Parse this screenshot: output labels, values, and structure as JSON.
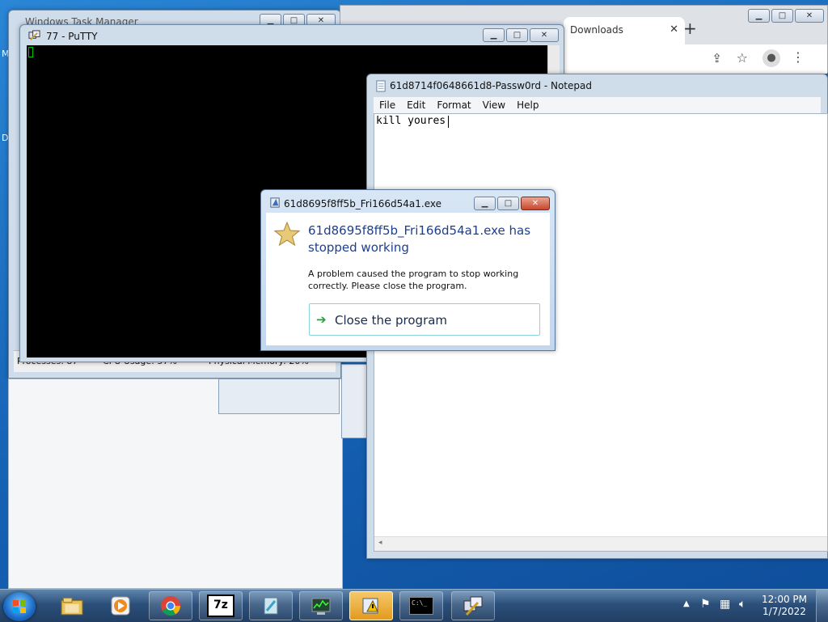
{
  "desktop": {
    "left_letter_1": "M",
    "left_letter_2": "D"
  },
  "task_manager": {
    "title": "Windows Task Manager",
    "status": {
      "processes": "Processes: 87",
      "cpu": "CPU Usage: 57%",
      "memory": "Physical Memory: 20%"
    }
  },
  "putty": {
    "title": "77 - PuTTY"
  },
  "chrome": {
    "tab_label": "Downloads",
    "new_tab": "+"
  },
  "notepad": {
    "title": "61d8714f0648661d8-Passw0rd - Notepad",
    "menu": [
      "File",
      "Edit",
      "Format",
      "View",
      "Help"
    ],
    "content": "kill youres"
  },
  "error_dialog": {
    "title": "61d8695f8ff5b_Fri166d54a1.exe",
    "heading": "61d8695f8ff5b_Fri166d54a1.exe has stopped working",
    "message": "A problem caused the program to stop working correctly. Please close the program.",
    "close_button": "Close the program"
  },
  "taskbar": {
    "items": [
      "explorer",
      "media-player",
      "chrome",
      "7zip",
      "notepad",
      "task-manager",
      "error-report",
      "cmd",
      "putty"
    ],
    "seven_zip_label": "7z",
    "cmd_label": "C:\\_",
    "time": "12:00 PM",
    "date": "1/7/2022"
  },
  "colors": {
    "accent_heading": "#1e3f8f",
    "taskbar_active": "#e39a1e",
    "putty_cursor": "#00c000"
  }
}
